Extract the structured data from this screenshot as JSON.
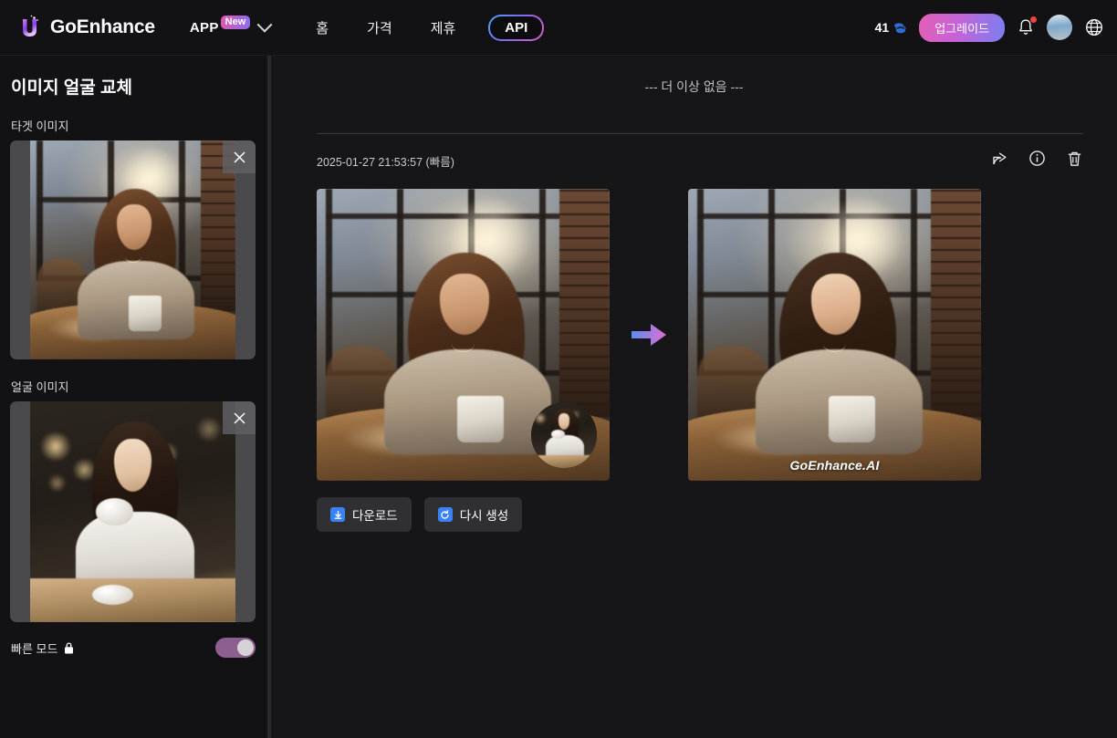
{
  "header": {
    "brand": "GoEnhance",
    "logo_icon": "goenhance-u-logo",
    "app_menu": {
      "label": "APP",
      "badge": "New",
      "chevron_icon": "chevron-down-icon"
    },
    "nav_items": [
      {
        "label": "홈",
        "name": "home"
      },
      {
        "label": "가격",
        "name": "pricing"
      },
      {
        "label": "제휴",
        "name": "affiliate"
      }
    ],
    "api_label": "API",
    "credits": {
      "value": "41",
      "icon": "coins-icon"
    },
    "upgrade_label": "업그레이드",
    "notification_icon": "bell-icon",
    "avatar_icon": "user-avatar",
    "language_icon": "globe-icon",
    "colors": {
      "upgrade_gradient_from": "#e25fb5",
      "upgrade_gradient_to": "#7b7ef0",
      "badge_gradient_from": "#e057b0",
      "badge_gradient_to": "#8b6df0",
      "notification_dot": "#ef4444",
      "header_bg": "#121214"
    }
  },
  "sidebar": {
    "title": "이미지 얼굴 교체",
    "target_section": {
      "label": "타겟 이미지",
      "remove_icon": "close-icon",
      "image_alt": "카페에 앉아 머그컵을 든 여성 사진"
    },
    "face_section": {
      "label": "얼굴 이미지",
      "remove_icon": "close-icon",
      "image_alt": "커피잔을 든 흰 블라우스 여성 사진"
    },
    "fast_mode": {
      "label": "빠른 모드",
      "lock_icon": "lock-icon",
      "enabled": true,
      "toggle_color": "#8c5f8e"
    }
  },
  "main": {
    "end_of_list": "--- 더 이상 없음 ---",
    "result": {
      "timestamp": "2025-01-27 21:53:57 (빠름)",
      "actions": [
        {
          "name": "share",
          "icon": "share-icon"
        },
        {
          "name": "info",
          "icon": "info-icon"
        },
        {
          "name": "delete",
          "icon": "trash-icon"
        }
      ],
      "source_image_alt": "카페의 여성 원본 이미지",
      "face_bubble_alt": "얼굴 소스 썸네일",
      "arrow_icon": "right-arrow-icon",
      "arrow_gradient_from": "#5b8cf0",
      "arrow_gradient_to": "#e06fd0",
      "output_image_alt": "얼굴이 교체된 결과 이미지",
      "watermark": "GoEnhance.AI",
      "buttons": [
        {
          "label": "다운로드",
          "icon": "download-icon",
          "name": "download"
        },
        {
          "label": "다시 생성",
          "icon": "regenerate-icon",
          "name": "regenerate"
        }
      ],
      "button_icon_color": "#3b82f6"
    }
  }
}
